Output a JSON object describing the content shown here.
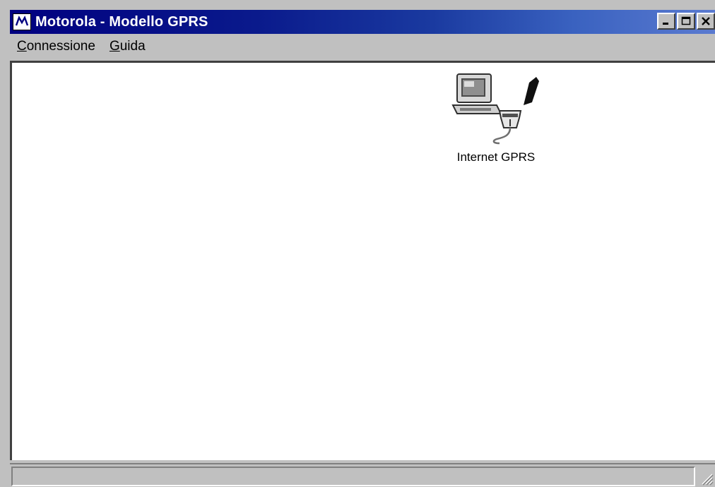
{
  "window": {
    "title": "Motorola - Modello GPRS",
    "app_icon": "motorola-logo-icon",
    "controls": [
      "minimize-icon",
      "maximize-icon",
      "close-icon"
    ]
  },
  "menubar": {
    "items": [
      {
        "underline": "C",
        "rest": "onnessione"
      },
      {
        "underline": "G",
        "rest": "uida"
      }
    ]
  },
  "connections": [
    {
      "label": "Internet GPRS",
      "icon": "dialup-connection-icon"
    }
  ],
  "status": {
    "text": ""
  },
  "colors": {
    "titlebar_start": "#000080",
    "titlebar_end": "#5a7ad0",
    "face": "#c0c0c0",
    "client": "#ffffff"
  }
}
